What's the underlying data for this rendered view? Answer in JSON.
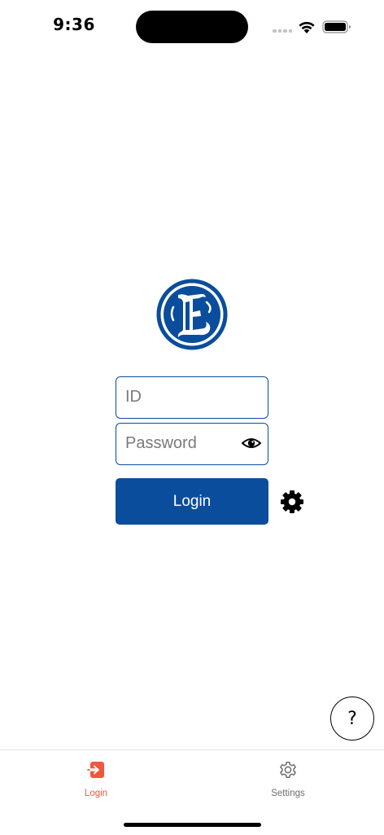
{
  "status_bar": {
    "time": "9:36"
  },
  "logo": {
    "letter": "E",
    "color": "#0a4d9c"
  },
  "login_form": {
    "id_placeholder": "ID",
    "id_value": "",
    "password_placeholder": "Password",
    "password_value": "",
    "login_label": "Login",
    "accent_color": "#0a4d9c"
  },
  "help": {
    "label": "?"
  },
  "tab_bar": {
    "items": [
      {
        "label": "Login",
        "icon": "login-arrow-icon",
        "active": true,
        "color": "#f0573c"
      },
      {
        "label": "Settings",
        "icon": "gear-icon",
        "active": false,
        "color": "#6d6d6d"
      }
    ]
  }
}
